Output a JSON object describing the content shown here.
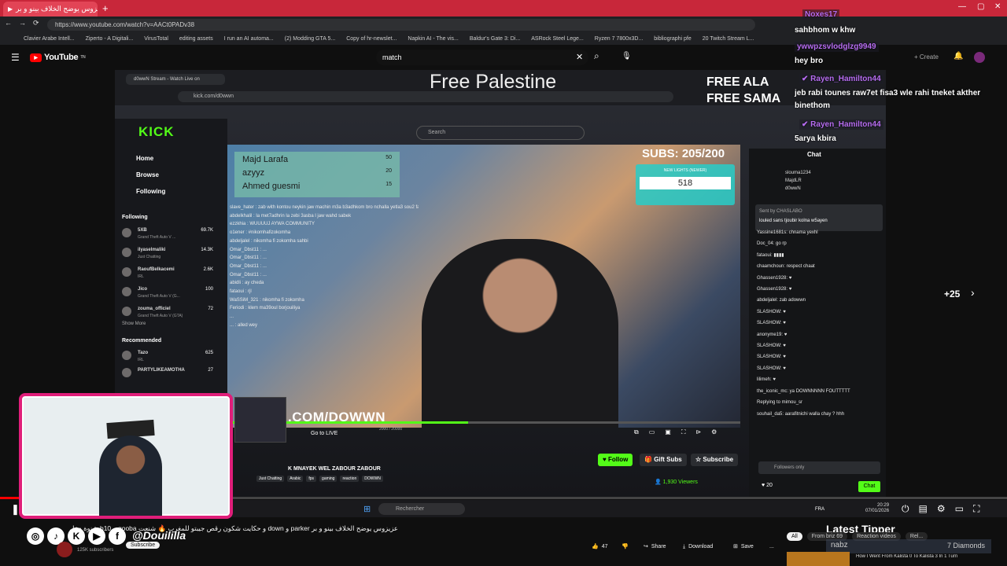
{
  "browser": {
    "tab_title": "عزيزوس يوضح الخلاف بينو و بر",
    "new_tab": "+",
    "url": "https://www.youtube.com/watch?v=AACt0PADv38",
    "bookmarks": [
      "Clavier Arabe Intell...",
      "Ziperto - A Digitali...",
      "VirusTotal",
      "editing assets",
      "I run an AI automa...",
      "(2) Modding GTA 5...",
      "Copy of hr-newslet...",
      "Napkin AI - The vis...",
      "Baldur's Gate 3: Di...",
      "ASRock Steel Lege...",
      "Ryzen 7 7800x3D...",
      "bibliographi pfe",
      "20 Twitch Stream L..."
    ]
  },
  "youtube": {
    "logo": "YouTube",
    "logo_sup": "TN",
    "search_value": "match",
    "create_label": "Create",
    "progress_fraction": 0.02
  },
  "stream": {
    "title": "Free Palestine",
    "free_lines": [
      "FREE ALA",
      "FREE SAMA"
    ],
    "kick_tab": "d0wwN Stream - Watch Live on",
    "kick_url": "kick.com/d0wwn",
    "kick_logo": "KICK",
    "kick_search": "Search",
    "nav": [
      "Home",
      "Browse",
      "Following"
    ],
    "following_heading": "Following",
    "following": [
      {
        "name": "5XB",
        "game": "Grand Theft Auto V ...",
        "viewers": "69.7K"
      },
      {
        "name": "ilyaselmaliki",
        "game": "Just Chatting",
        "viewers": "14.3K"
      },
      {
        "name": "RaoufBelkacemi",
        "game": "IRL",
        "viewers": "2.6K"
      },
      {
        "name": "Jico",
        "game": "Grand Theft Auto V (G...",
        "viewers": "100"
      },
      {
        "name": "zouma_officiel",
        "game": "Grand Theft Auto V (GTA)",
        "viewers": "72"
      }
    ],
    "show_more": "Show More",
    "recommended_heading": "Recommended",
    "recommended": [
      {
        "name": "Tazo",
        "game": "IRL",
        "viewers": "625"
      },
      {
        "name": "PARTYLIKEAMOTHA",
        "game": "",
        "viewers": "27"
      }
    ],
    "leaderboard": [
      {
        "name": "Majd Larafa",
        "score": "50"
      },
      {
        "name": "azyyz",
        "score": "20"
      },
      {
        "name": "Ahmed guesmi",
        "score": "15"
      }
    ],
    "subs_goal": "SUBS: 205/200",
    "lights_label": "NEW LIGHTS (NEWER)",
    "lights_value": "518",
    "overlay_chat": [
      "slave_hater : zab with kontou neykin jaw machin m3a b3adhkom bro nchalla yetla3 sou2 fahm",
      "abdelkhalil : la met7adhrin la zebi 3asba l jaw wahd sabek",
      "ezzkhia : WUUUUJ AYWA COMMUNITY",
      "o1ener : #nikomhafizokomha",
      "abdeljalel : nikomha fi zokomha sahbi",
      "Omar_Dbst11 : ...",
      "Omar_Dbst11 : ...",
      "Omar_Dbst11 : ...",
      "Omar_Dbst11 : ...",
      "abidli : ay cheda",
      "fataoui : rjl",
      "WaSSiM_321 : nikomha fi zokomha",
      "Feriodi : klem ma39oul borjouiliya",
      "...",
      "... : alled wey"
    ],
    "banner": ".COM/DOWWN",
    "go_to_live": "Go to LIVE",
    "time_display": "2000 / 20000",
    "scrub_fraction": 0.47,
    "channel_title": "K MNAYEK WEL ZABOUR ZABOUR",
    "channel_tags": [
      "Just Chatting",
      "Arabic",
      "fps",
      "gaming",
      "reaction",
      "DOWWN"
    ],
    "follow_label": "Follow",
    "gift_label": "Gift Subs",
    "subscribe_label": "Subscribe",
    "viewers": "1,930 Viewers",
    "chat_title": "Chat",
    "chat_top": [
      "slouma1234",
      "MajdLR",
      "d0wwN"
    ],
    "sent_by": "Sent by  CHASLABO",
    "pinned_msg": "louled sans tjoubir kolna w5ayen",
    "kick_chat": [
      "Yassine1681s: chnama yexhl",
      "Doc_04: go rp",
      "fataoui: ▮▮▮▮",
      "chaamchoun: respect chaat",
      "Ghassen1928: ♥",
      "Ghassen1928: ♥",
      "abdeljalel: zab adowwn",
      "SLASHOW: ♥",
      "SLASHOW: ♥",
      "anonyme19: ♥",
      "SLASHOW: ♥",
      "SLASHOW: ♥",
      "SLASHOW: ♥",
      "lilimeh: ♥",
      "the_iconic_mc: ya DOWNNNNN FOUTTTTT",
      "Replying to mimou_sr",
      "souhail_da5: aarafitnichi walla chay ? hhh"
    ],
    "followers_only": "Followers only",
    "chat_count": "20",
    "chat_btn": "Chat",
    "plus_more": "+25",
    "windows_search": "Rechercher",
    "clock_time": "20:29",
    "clock_date": "07/01/2026",
    "lang": "FRA"
  },
  "floating_chat": [
    {
      "name": "Noxes17",
      "msg": "sahbhom w khw"
    },
    {
      "name": "ywwpzsvlodglzg9949",
      "msg": "hey bro"
    },
    {
      "name": "Rayen_Hamilton44",
      "msg": "jeb rabi tounes raw7et fisa3 wle rahi tneket akther binethom"
    },
    {
      "name": "Rayen_Hamilton44",
      "msg": "5arya kbira"
    }
  ],
  "overlay": {
    "handle": "@Douililla",
    "latest_tipper": "Latest Tipper",
    "tipper_name": "nabz",
    "tipper_amount": "7 Diamonds"
  },
  "video_info": {
    "title": "عزيزوس يوضح الخلاف بينو و بر parker و down و حكايت شكون رقص جيبتو للمغرب 🔥 شنعت gooba و b10 شنوة دخل",
    "subscribe": "Subscribe",
    "subscribers": "125K subscribers",
    "likes": "47",
    "share": "Share",
    "download": "Download",
    "save": "Save",
    "more": "...",
    "chips": [
      "All",
      "From briz 69",
      "Reaction videos",
      "Rel..."
    ],
    "rec_title": "How I Went From Kalista 0 To Kalista 3 In 1 Turn"
  },
  "colors": {
    "kick_green": "#53fc18",
    "tab_red": "#c8273a",
    "cam_border": "#e01e7a",
    "chat_name": "#b66cf0"
  }
}
